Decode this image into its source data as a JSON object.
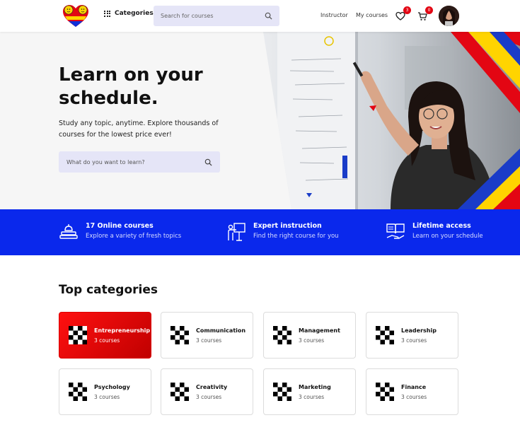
{
  "header": {
    "categories_label": "Categories",
    "search_placeholder": "Search for courses",
    "instructor_label": "Instructor",
    "my_courses_label": "My courses",
    "wishlist_count": "3",
    "cart_count": "0"
  },
  "hero": {
    "title": "Learn on your schedule.",
    "subtitle": "Study any topic, anytime. Explore thousands of courses for the lowest price ever!",
    "search_placeholder": "What do you want to learn?"
  },
  "features": [
    {
      "icon": "online-courses-icon",
      "title": "17 Online courses",
      "subtitle": "Explore a variety of fresh topics"
    },
    {
      "icon": "instructor-icon",
      "title": "Expert instruction",
      "subtitle": "Find the right course for you"
    },
    {
      "icon": "book-hand-icon",
      "title": "Lifetime access",
      "subtitle": "Learn on your schedule"
    }
  ],
  "categories": {
    "title": "Top categories",
    "items": [
      {
        "name": "Entrepreneurship",
        "count": "3 courses"
      },
      {
        "name": "Communication",
        "count": "3 courses"
      },
      {
        "name": "Management",
        "count": "3 courses"
      },
      {
        "name": "Leadership",
        "count": "3 courses"
      },
      {
        "name": "Psychology",
        "count": "3 courses"
      },
      {
        "name": "Creativity",
        "count": "3 courses"
      },
      {
        "name": "Marketing",
        "count": "3 courses"
      },
      {
        "name": "Finance",
        "count": "3 courses"
      }
    ]
  },
  "colors": {
    "accent_blue": "#0a28ec",
    "active_red": "#e50000",
    "search_bg": "#e5e5f7",
    "badge_red": "#e30613"
  }
}
